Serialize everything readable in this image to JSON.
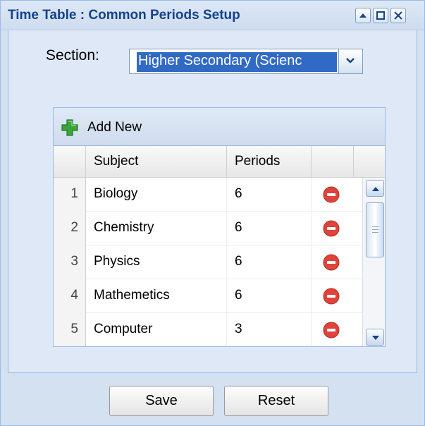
{
  "window": {
    "title": "Time Table : Common Periods Setup",
    "tools": [
      "collapse-icon",
      "maximize-icon",
      "close-icon"
    ]
  },
  "section": {
    "label": "Section:",
    "value": "Higher Secondary (Scienc"
  },
  "grid": {
    "toolbar": {
      "add_label": "Add New",
      "add_icon": "plus-icon",
      "add_icon_color": "#3aa33a"
    },
    "columns": {
      "subject": "Subject",
      "periods": "Periods"
    },
    "rows": [
      {
        "num": "1",
        "subject": "Biology",
        "periods": "6"
      },
      {
        "num": "2",
        "subject": "Chemistry",
        "periods": "6"
      },
      {
        "num": "3",
        "subject": "Physics",
        "periods": "6"
      },
      {
        "num": "4",
        "subject": "Mathemetics",
        "periods": "6"
      },
      {
        "num": "5",
        "subject": "Computer",
        "periods": "3"
      }
    ],
    "delete_icon": "minus-circle-icon",
    "delete_icon_color": "#e0433a"
  },
  "buttons": {
    "save": "Save",
    "reset": "Reset"
  },
  "colors": {
    "title_text": "#15428b",
    "window_bg": "#d3e1f1",
    "selection": "#316ac5"
  }
}
